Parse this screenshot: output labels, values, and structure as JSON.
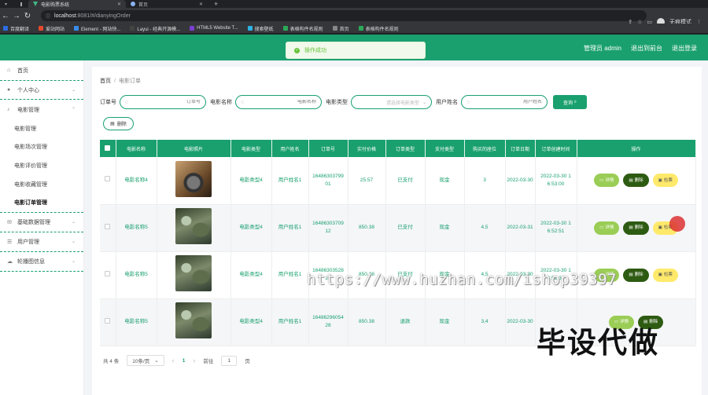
{
  "browser": {
    "tabs": [
      {
        "title": "电影购票系统",
        "active": true
      },
      {
        "title": "首页",
        "active": false
      }
    ],
    "new_tab": "+",
    "url_host": "localhost",
    "url_path": ":8081/#/dianyingOrder",
    "profile_label": "无痕模式",
    "bookmarks": [
      {
        "label": "百度翻译",
        "color": "#2d6de3"
      },
      {
        "label": "爱站网站",
        "color": "#e34a2d"
      },
      {
        "label": "Element - 网站快...",
        "color": "#3b8be8"
      },
      {
        "label": "Layui - 经典开源模...",
        "color": "#444"
      },
      {
        "label": "HTML5 Website T...",
        "color": "#7a3fd0"
      },
      {
        "label": "搜索壁纸",
        "color": "#2db2e3"
      },
      {
        "label": "表格构件名规则",
        "color": "#2da85a"
      },
      {
        "label": "首页",
        "color": "#888"
      },
      {
        "label": "表格构件名规则",
        "color": "#2da85a"
      }
    ]
  },
  "header": {
    "admin_label": "管理员 admin",
    "back_label": "退出到前台",
    "logout_label": "退出登录",
    "accent": "#1aa06f"
  },
  "toast": {
    "text": "操作成功"
  },
  "sidebar": {
    "items": [
      {
        "label": "首页",
        "icon": "home-icon"
      },
      {
        "label": "个人中心",
        "icon": "user-icon"
      },
      {
        "label": "电影管理",
        "icon": "mic-icon"
      }
    ],
    "sub_items": [
      {
        "label": "电影管理",
        "active": false
      },
      {
        "label": "电影场次管理",
        "active": false
      },
      {
        "label": "电影评价管理",
        "active": false
      },
      {
        "label": "电影收藏管理",
        "active": false
      },
      {
        "label": "电影订单管理",
        "active": true
      }
    ],
    "bottom_items": [
      {
        "label": "基础数据管理",
        "icon": "mail-icon"
      },
      {
        "label": "用户管理",
        "icon": "list-icon"
      },
      {
        "label": "轮播图信息",
        "icon": "cloud-icon"
      }
    ]
  },
  "breadcrumb": {
    "home": "首页",
    "sep": "/",
    "current": "电影订单"
  },
  "filters": {
    "order_no_label": "订单号",
    "order_no_ph": "订单号",
    "movie_name_label": "电影名称",
    "movie_name_ph": "电影名称",
    "movie_type_label": "电影类型",
    "movie_type_ph": "请选择电影类型",
    "user_name_label": "用户姓名",
    "user_name_ph": "用户姓名",
    "search_label": "查询"
  },
  "delete_label": "删除",
  "table": {
    "headers": [
      "电影名称",
      "电影照片",
      "电影类型",
      "用户姓名",
      "订单号",
      "实付价格",
      "订单类型",
      "支付类型",
      "购买的座位",
      "订单日期",
      "订单创建时间",
      "操作"
    ],
    "rows": [
      {
        "name": "电影名称4",
        "thumb": "t1",
        "type": "电影类型4",
        "user": "用户姓名1",
        "order_no": "1648630379901",
        "price": "25.57",
        "order_type": "已支付",
        "pay_type": "现金",
        "seats": "3",
        "date": "2022-03-30",
        "created": "2022-03-30 16:53:00",
        "ops": [
          "详情",
          "删除",
          "检票"
        ]
      },
      {
        "name": "电影名称5",
        "thumb": "t2",
        "type": "电影类型4",
        "user": "用户姓名1",
        "order_no": "1648630370912",
        "price": "850.38",
        "order_type": "已支付",
        "pay_type": "现金",
        "seats": "4,5",
        "date": "2022-03-31",
        "created": "2022-03-30 16:52:51",
        "ops": [
          "详情",
          "删除",
          "检票"
        ]
      },
      {
        "name": "电影名称5",
        "thumb": "t2",
        "type": "电影类型4",
        "user": "用户姓名1",
        "order_no": "1648630352821",
        "price": "850.38",
        "order_type": "已支付",
        "pay_type": "现金",
        "seats": "4,5",
        "date": "2022-03-30",
        "created": "2022-03-30 16:52:32",
        "ops": [
          "详情",
          "删除",
          "检票"
        ]
      },
      {
        "name": "电影名称5",
        "thumb": "t2",
        "type": "电影类型4",
        "user": "用户姓名1",
        "order_no": "1648629605428",
        "price": "850.38",
        "order_type": "退款",
        "pay_type": "现金",
        "seats": "3,4",
        "date": "2022-03-30",
        "created": "",
        "ops": [
          "详情",
          "删除"
        ]
      }
    ]
  },
  "pager": {
    "total": "共 4 条",
    "page_size": "10条/页",
    "prev": "‹",
    "page": "1",
    "next": "›",
    "goto": "前往",
    "goto_value": "1",
    "unit": "页"
  },
  "watermark": {
    "url": "https://www.huzhan.com/ishop39397",
    "big": "毕设代做"
  }
}
